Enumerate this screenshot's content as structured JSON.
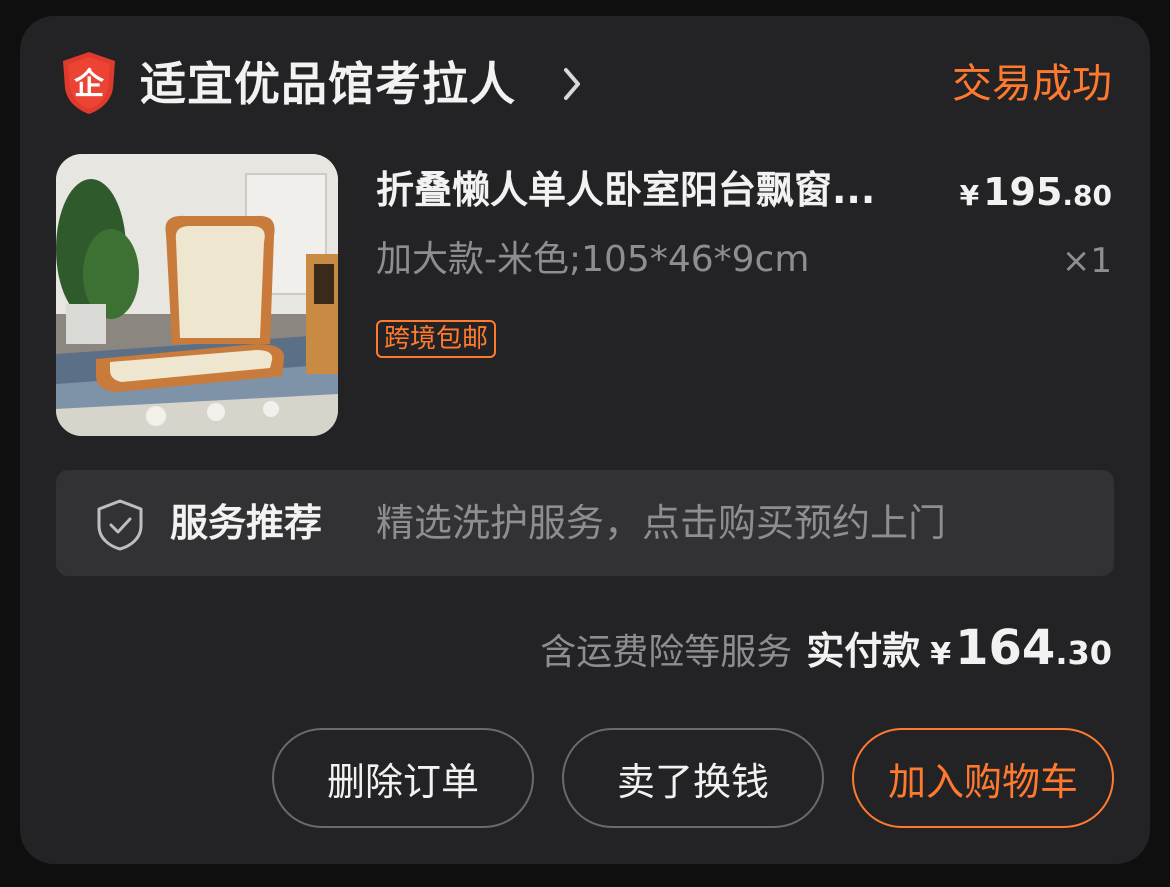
{
  "shop": {
    "icon": "enterprise-shield-icon",
    "icon_glyph": "企",
    "name": "适宜优品馆考拉人"
  },
  "order": {
    "status": "交易成功",
    "item": {
      "title": "折叠懒人单人卧室阳台飘窗...",
      "spec": "加大款-米色;105*46*9cm",
      "price_currency": "¥",
      "price_int": "195",
      "price_dec": ".80",
      "quantity": "×1",
      "tag": "跨境包邮"
    },
    "service": {
      "icon": "shield-check-icon",
      "label": "服务推荐",
      "desc": "精选洗护服务，点击购买预约上门"
    },
    "total": {
      "note": "含运费险等服务",
      "label": "实付款",
      "currency": "¥",
      "int": "164",
      "dec": ".30"
    },
    "actions": {
      "delete": "删除订单",
      "sell": "卖了换钱",
      "add_to_cart": "加入购物车"
    }
  },
  "colors": {
    "accent": "#ff7a2e",
    "shield_red": "#e03a2c",
    "card_bg": "#232325",
    "page_bg": "#0f0f10"
  }
}
